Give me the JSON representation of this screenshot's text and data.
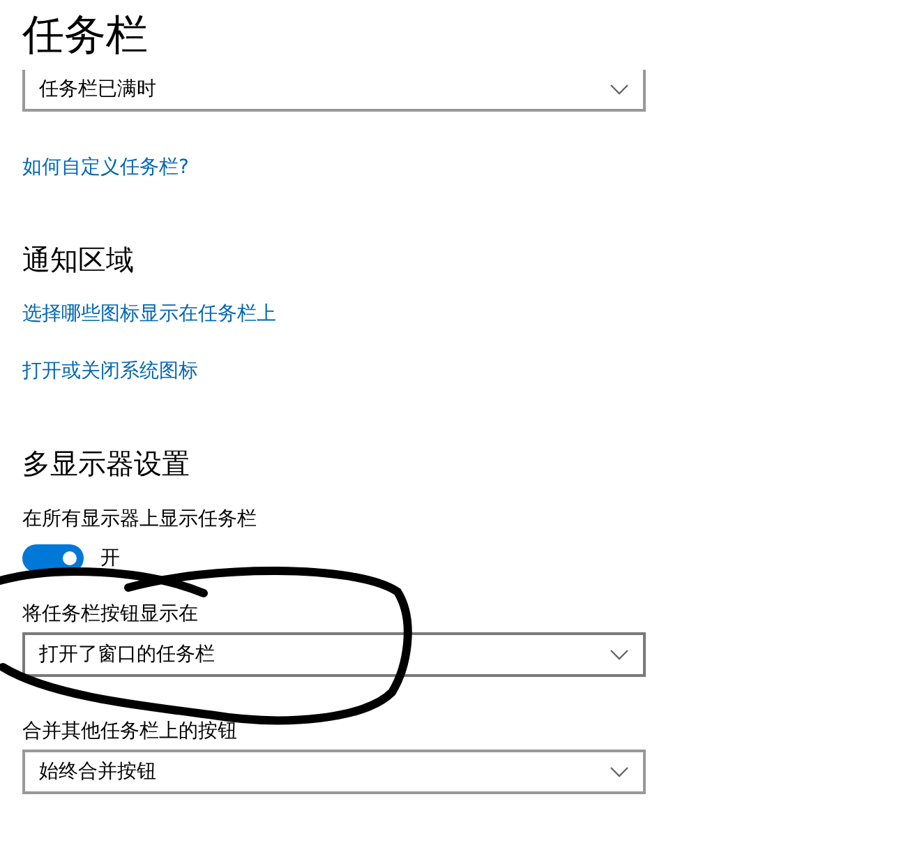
{
  "items": [
    {
      "kind": "title",
      "text": "任务栏"
    },
    {
      "kind": "dropdown",
      "value": "任务栏已满时"
    },
    {
      "kind": "link",
      "text": "如何自定义任务栏?"
    },
    {
      "kind": "heading",
      "text": "通知区域"
    },
    {
      "kind": "link",
      "text": "选择哪些图标显示在任务栏上"
    },
    {
      "kind": "link",
      "text": "打开或关闭系统图标"
    },
    {
      "kind": "heading",
      "text": "多显示器设置"
    },
    {
      "kind": "label",
      "text": "在所有显示器上显示任务栏"
    },
    {
      "kind": "toggle",
      "on": true,
      "text": "开"
    },
    {
      "kind": "label",
      "text": "将任务栏按钮显示在"
    },
    {
      "kind": "dropdown",
      "value": "打开了窗口的任务栏"
    },
    {
      "kind": "label",
      "text": "合并其他任务栏上的按钮"
    },
    {
      "kind": "dropdown",
      "value": "始终合并按钮"
    }
  ]
}
